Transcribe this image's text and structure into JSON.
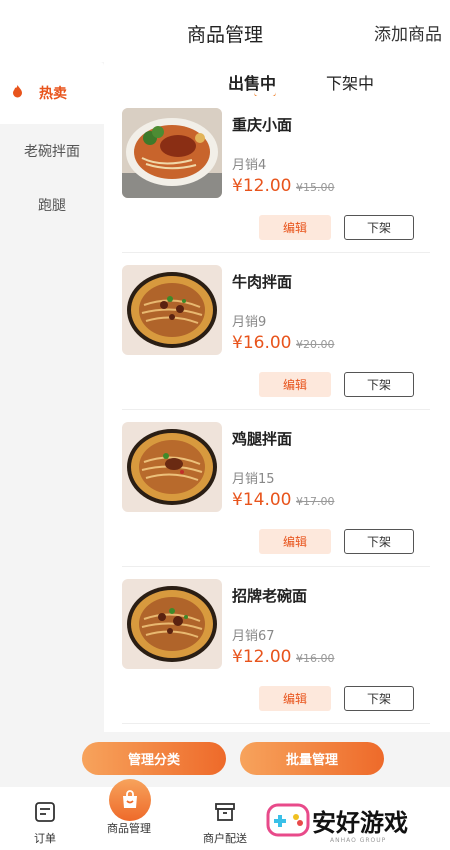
{
  "header": {
    "title": "商品管理",
    "add_label": "添加商品"
  },
  "sidebar": {
    "items": [
      {
        "label": "热卖",
        "active": true
      },
      {
        "label": "老碗拌面",
        "active": false
      },
      {
        "label": "跑腿",
        "active": false
      }
    ]
  },
  "tabs": [
    {
      "label": "出售中",
      "active": true
    },
    {
      "label": "下架中",
      "active": false
    }
  ],
  "products": [
    {
      "name": "重庆小面",
      "sales": "月销4",
      "price": "¥12.00",
      "original_price": "¥15.00",
      "edit_label": "编辑",
      "offshelf_label": "下架"
    },
    {
      "name": "牛肉拌面",
      "sales": "月销9",
      "price": "¥16.00",
      "original_price": "¥20.00",
      "edit_label": "编辑",
      "offshelf_label": "下架"
    },
    {
      "name": "鸡腿拌面",
      "sales": "月销15",
      "price": "¥14.00",
      "original_price": "¥17.00",
      "edit_label": "编辑",
      "offshelf_label": "下架"
    },
    {
      "name": "招牌老碗面",
      "sales": "月销67",
      "price": "¥12.00",
      "original_price": "¥16.00",
      "edit_label": "编辑",
      "offshelf_label": "下架"
    }
  ],
  "actions": {
    "manage_category": "管理分类",
    "batch_manage": "批量管理"
  },
  "tabbar": {
    "orders": "订单",
    "products": "商品管理",
    "delivery": "商户配送"
  },
  "watermark": {
    "text": "安好游戏",
    "sub": "ANHAO GROUP"
  },
  "colors": {
    "accent": "#e8541c",
    "accent_light": "#fde8dc",
    "gradient_start": "#f7a35c",
    "gradient_end": "#ee6a2a"
  }
}
